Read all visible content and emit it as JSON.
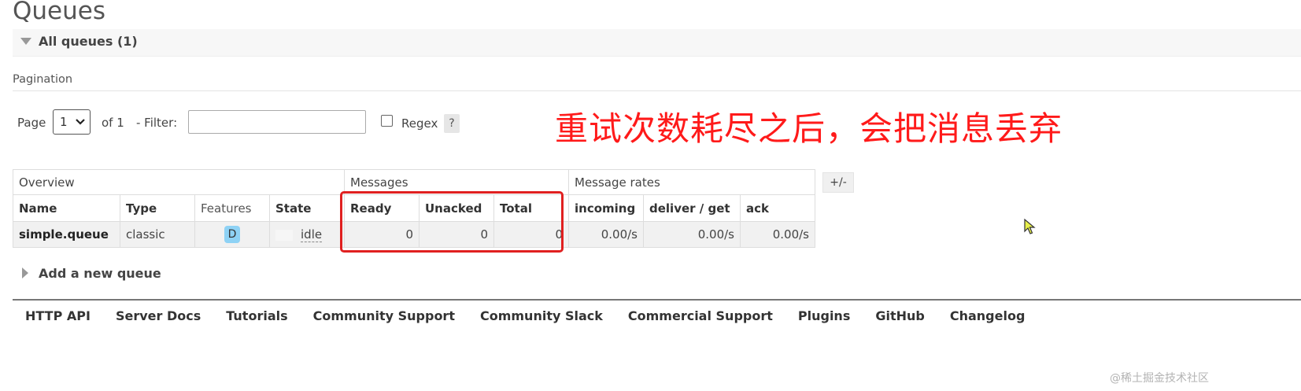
{
  "page": {
    "title": "Queues"
  },
  "section": {
    "title": "All queues (1)"
  },
  "pagination": {
    "label": "Pagination",
    "page_label": "Page",
    "page_value": "1",
    "of_label": "of 1",
    "filter_label": "- Filter:",
    "filter_value": "",
    "regex_label": "Regex",
    "help_label": "?"
  },
  "annotation": "重试次数耗尽之后，会把消息丢弃",
  "table": {
    "groups": {
      "overview": "Overview",
      "messages": "Messages",
      "rates": "Message rates"
    },
    "columns": {
      "name": "Name",
      "type": "Type",
      "features": "Features",
      "state": "State",
      "ready": "Ready",
      "unacked": "Unacked",
      "total": "Total",
      "incoming": "incoming",
      "deliver_get": "deliver / get",
      "ack": "ack"
    },
    "rows": [
      {
        "name": "simple.queue",
        "type": "classic",
        "feature": "D",
        "state": "idle",
        "ready": "0",
        "unacked": "0",
        "total": "0",
        "incoming": "0.00/s",
        "deliver_get": "0.00/s",
        "ack": "0.00/s"
      }
    ],
    "toggle_label": "+/-"
  },
  "add_queue": {
    "label": "Add a new queue"
  },
  "footer": {
    "links": [
      "HTTP API",
      "Server Docs",
      "Tutorials",
      "Community Support",
      "Community Slack",
      "Commercial Support",
      "Plugins",
      "GitHub",
      "Changelog"
    ]
  },
  "watermark": "@稀土掘金技术社区",
  "colors": {
    "annotation": "#ff1a1a",
    "highlight": "#e02020",
    "feature_badge": "#8ed2f5"
  }
}
